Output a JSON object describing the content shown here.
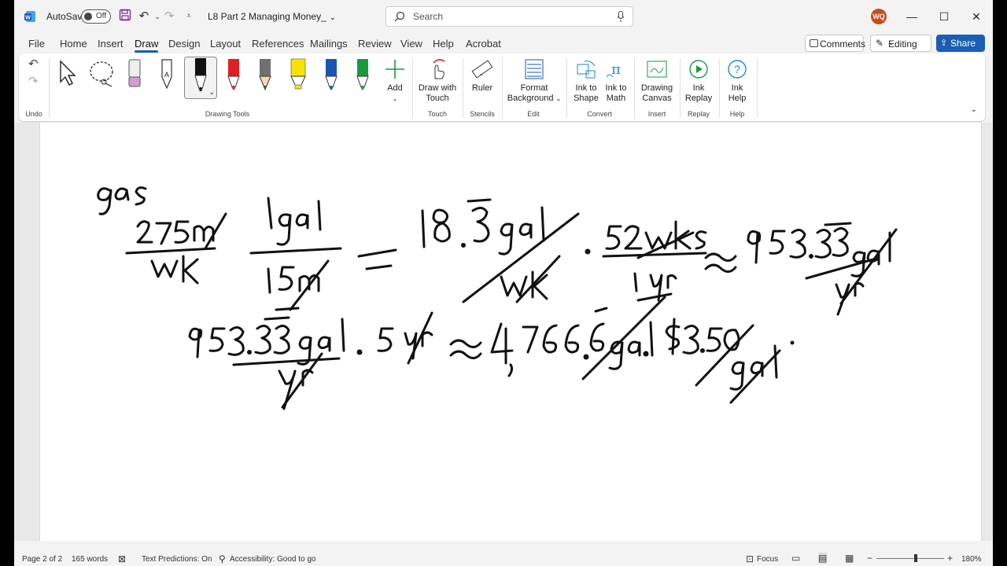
{
  "titlebar": {
    "autosave_label": "AutoSave",
    "autosave_state": "Off",
    "doc_title": "L8 Part 2 Managing Money_",
    "search_placeholder": "Search",
    "user_initials": "WQ"
  },
  "menu": [
    "File",
    "Home",
    "Insert",
    "Draw",
    "Design",
    "Layout",
    "References",
    "Mailings",
    "Review",
    "View",
    "Help",
    "Acrobat"
  ],
  "actions": {
    "comments": "Comments",
    "editing": "Editing",
    "share": "Share"
  },
  "ribbon": {
    "groups": {
      "undo": "Undo",
      "drawing_tools": "Drawing Tools",
      "touch": "Touch",
      "stencils": "Stencils",
      "edit": "Edit",
      "convert": "Convert",
      "insert": "Insert",
      "replay": "Replay",
      "help": "Help"
    },
    "buttons": {
      "add": "Add",
      "draw_with_touch": [
        "Draw with",
        "Touch"
      ],
      "ruler": "Ruler",
      "format_background": [
        "Format",
        "Background"
      ],
      "ink_to_shape": [
        "Ink to",
        "Shape"
      ],
      "ink_to_math": [
        "Ink to",
        "Math"
      ],
      "drawing_canvas": [
        "Drawing",
        "Canvas"
      ],
      "ink_replay": [
        "Ink",
        "Replay"
      ],
      "ink_help": [
        "Ink",
        "Help"
      ]
    },
    "pen_colors": [
      "#000000",
      "#e02020",
      "#707070",
      "#f5e400",
      "#1a56b0",
      "#1a9a3a"
    ]
  },
  "status": {
    "page": "Page 2 of 2",
    "words": "165 words",
    "predictions": "Text Predictions: On",
    "accessibility": "Accessibility: Good to go",
    "focus": "Focus",
    "zoom": "180%"
  }
}
